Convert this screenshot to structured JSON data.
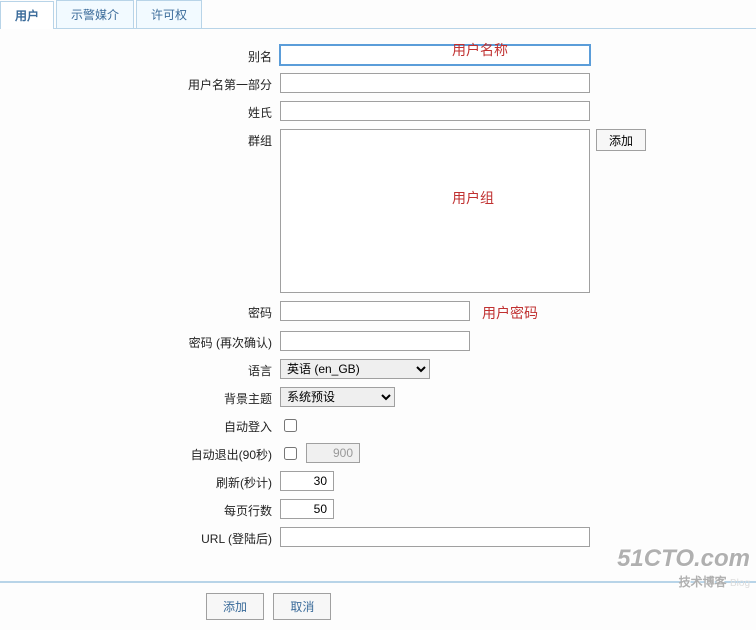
{
  "tabs": {
    "user": "用户",
    "alert_media": "示警媒介",
    "permissions": "许可权"
  },
  "labels": {
    "alias": "别名",
    "username_first": "用户名第一部分",
    "surname": "姓氏",
    "groups": "群组",
    "password": "密码",
    "password_confirm": "密码 (再次确认)",
    "language": "语言",
    "theme": "背景主题",
    "auto_login": "自动登入",
    "auto_logout": "自动退出(90秒)",
    "refresh": "刷新(秒计)",
    "rows_per_page": "每页行数",
    "url_after_login": "URL (登陆后)"
  },
  "values": {
    "alias": "",
    "username_first": "",
    "surname": "",
    "groups": "",
    "language_selected": "英语 (en_GB)",
    "theme_selected": "系统预设",
    "auto_login": false,
    "auto_logout": "900",
    "refresh": "30",
    "rows_per_page": "50",
    "url_after_login": ""
  },
  "buttons": {
    "add_group": "添加",
    "add": "添加",
    "cancel": "取消"
  },
  "annotations": {
    "username": "用户名称",
    "usergroup": "用户组",
    "userpassword": "用户密码"
  },
  "watermark": {
    "main": "51CTO.com",
    "sub": "技术博客",
    "blog": "Blog"
  }
}
